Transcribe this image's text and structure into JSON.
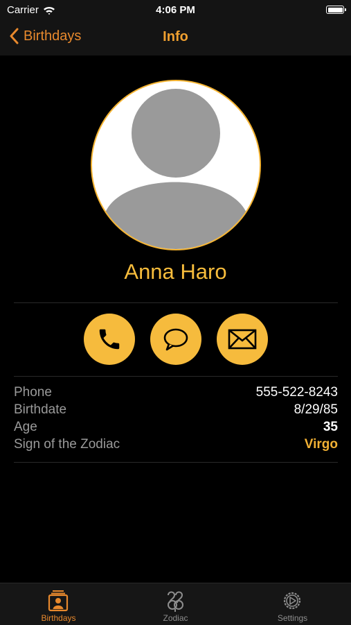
{
  "status_bar": {
    "carrier": "Carrier",
    "time": "4:06 PM"
  },
  "nav": {
    "back_label": "Birthdays",
    "title": "Info"
  },
  "contact": {
    "name": "Anna Haro",
    "fields": [
      {
        "label": "Phone",
        "value": "555-522-8243"
      },
      {
        "label": "Birthdate",
        "value": "8/29/85"
      },
      {
        "label": "Age",
        "value": "35"
      },
      {
        "label": "Sign of the Zodiac",
        "value": "Virgo"
      }
    ]
  },
  "actions": [
    {
      "name": "call",
      "icon": "phone-icon"
    },
    {
      "name": "message",
      "icon": "speech-bubble-icon"
    },
    {
      "name": "email",
      "icon": "envelope-icon"
    }
  ],
  "tabs": [
    {
      "label": "Birthdays",
      "icon": "contact-card-icon",
      "active": true
    },
    {
      "label": "Zodiac",
      "icon": "zodiac-icon",
      "active": false
    },
    {
      "label": "Settings",
      "icon": "gear-icon",
      "active": false
    }
  ],
  "colors": {
    "accent": "#f6bb3d",
    "nav_accent": "#e8892d",
    "background": "#000000",
    "bar_background": "#141414",
    "label_gray": "#9a9a9a"
  }
}
